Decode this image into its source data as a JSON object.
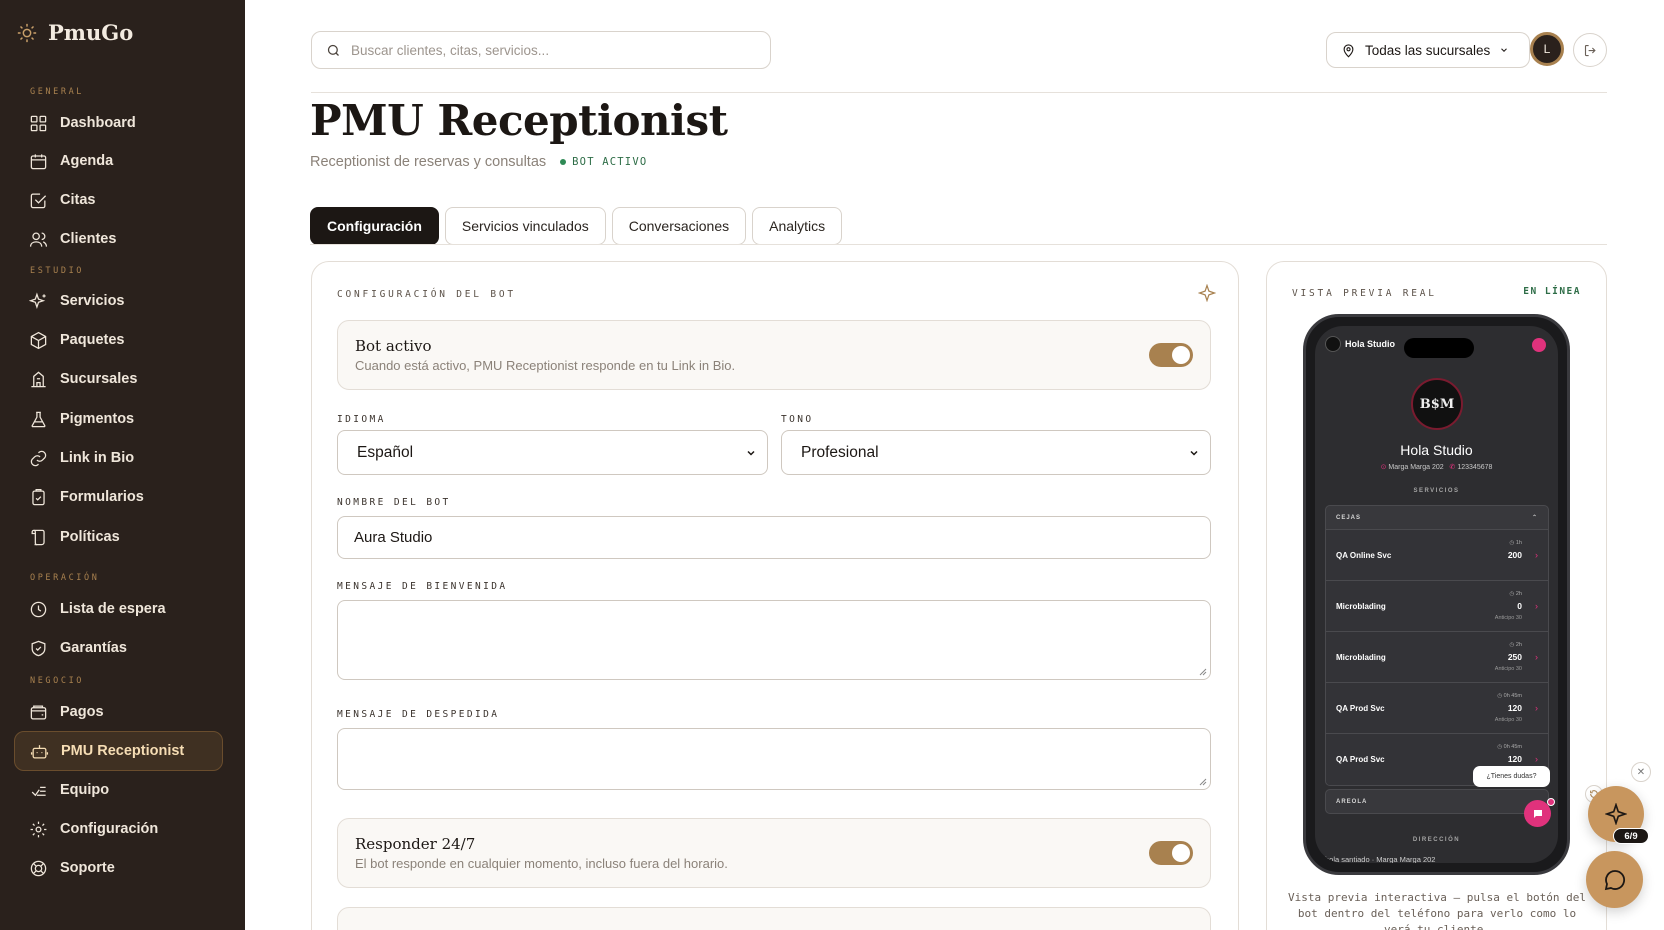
{
  "brand": {
    "name": "PmuGo"
  },
  "sidebar": {
    "sections": [
      {
        "title": "GENERAL"
      },
      {
        "title": "ESTUDIO"
      },
      {
        "title": "OPERACIÓN"
      },
      {
        "title": "NEGOCIO"
      }
    ],
    "items": [
      {
        "label": "Dashboard",
        "icon": "grid-icon"
      },
      {
        "label": "Agenda",
        "icon": "calendar-icon"
      },
      {
        "label": "Citas",
        "icon": "check-square-icon"
      },
      {
        "label": "Clientes",
        "icon": "users-icon"
      },
      {
        "label": "Servicios",
        "icon": "sparkles-icon"
      },
      {
        "label": "Paquetes",
        "icon": "package-icon"
      },
      {
        "label": "Sucursales",
        "icon": "building-icon"
      },
      {
        "label": "Pigmentos",
        "icon": "flask-icon"
      },
      {
        "label": "Link in Bio",
        "icon": "link-icon"
      },
      {
        "label": "Formularios",
        "icon": "clipboard-icon"
      },
      {
        "label": "Políticas",
        "icon": "scroll-icon"
      },
      {
        "label": "Lista de espera",
        "icon": "clock-icon"
      },
      {
        "label": "Garantías",
        "icon": "shield-icon"
      },
      {
        "label": "Pagos",
        "icon": "wallet-icon"
      },
      {
        "label": "PMU Receptionist",
        "icon": "bot-icon",
        "active": true
      },
      {
        "label": "Equipo",
        "icon": "team-icon"
      },
      {
        "label": "Configuración",
        "icon": "gear-icon"
      },
      {
        "label": "Soporte",
        "icon": "lifebuoy-icon"
      }
    ]
  },
  "topbar": {
    "search_placeholder": "Buscar clientes, citas, servicios...",
    "branch_label": "Todas las sucursales",
    "avatar_initial": "L"
  },
  "header": {
    "title": "PMU Receptionist",
    "subtitle": "Receptionist de reservas y consultas",
    "status": "BOT ACTIVO"
  },
  "tabs": [
    {
      "label": "Configuración",
      "active": true
    },
    {
      "label": "Servicios vinculados"
    },
    {
      "label": "Conversaciones"
    },
    {
      "label": "Analytics"
    }
  ],
  "config": {
    "header": "CONFIGURACIÓN DEL BOT",
    "bot_active": {
      "title": "Bot activo",
      "description": "Cuando está activo, PMU Receptionist responde en tu Link in Bio.",
      "enabled": true
    },
    "language": {
      "label": "IDIOMA",
      "value": "Español"
    },
    "tone": {
      "label": "TONO",
      "value": "Profesional"
    },
    "bot_name": {
      "label": "NOMBRE DEL BOT",
      "value": "Aura Studio"
    },
    "welcome": {
      "label": "MENSAJE DE BIENVENIDA",
      "value": ""
    },
    "farewell": {
      "label": "MENSAJE DE DESPEDIDA",
      "value": ""
    },
    "respond_247": {
      "title": "Responder 24/7",
      "description": "El bot responde en cualquier momento, incluso fuera del horario.",
      "enabled": true
    }
  },
  "preview": {
    "label": "VISTA PREVIA REAL",
    "status": "EN LÍNEA",
    "caption": "Vista previa interactiva — pulsa el botón del bot dentro del teléfono para verlo como lo verá tu cliente.",
    "phone": {
      "top_name": "Hola Studio",
      "logo_text": "B$M",
      "studio_name": "Hola Studio",
      "address_short": "Marga Marga 202",
      "phone": "123345678",
      "services_section": "SERVICIOS",
      "category": "CEJAS",
      "services": [
        {
          "name": "QA Online Svc",
          "duration": "1h",
          "price": "200",
          "deposit": ""
        },
        {
          "name": "Microblading",
          "duration": "2h",
          "price": "0",
          "deposit": "Anticipo 30"
        },
        {
          "name": "Microblading",
          "duration": "2h",
          "price": "250",
          "deposit": "Anticipo 30"
        },
        {
          "name": "QA Prod Svc",
          "duration": "0h 45m",
          "price": "120",
          "deposit": "Anticipo 30"
        },
        {
          "name": "QA Prod Svc",
          "duration": "0h 45m",
          "price": "120",
          "deposit": ""
        }
      ],
      "category2": "AREOLA",
      "address_section": "DIRECCIÓN",
      "address": "hola santiado · Marga Marga 202",
      "tooltip": "¿Tienes dudas?"
    }
  },
  "floating": {
    "badge": "6/9"
  },
  "colors": {
    "accent": "#a8814f",
    "sidebar": "#2a211c",
    "status_green": "#2e6d47",
    "pink": "#e0327c"
  }
}
